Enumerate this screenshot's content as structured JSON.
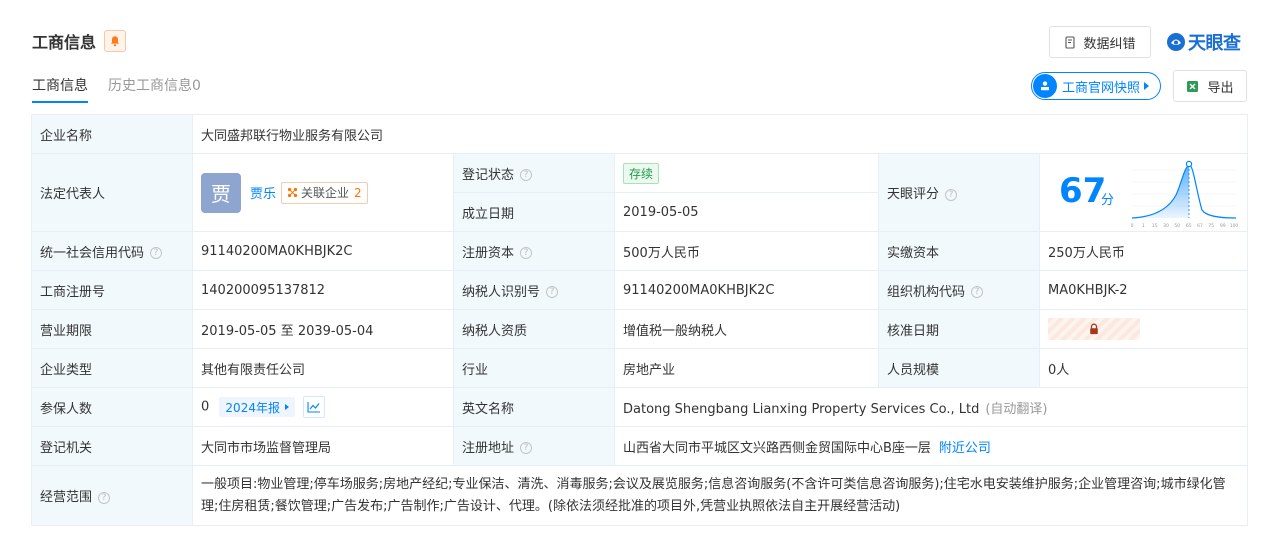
{
  "header": {
    "title": "工商信息",
    "correct_button": "数据纠错",
    "brand": "天眼查"
  },
  "tabs": [
    {
      "label": "工商信息"
    },
    {
      "label": "历史工商信息0"
    }
  ],
  "actions": {
    "snapshot_label": "工商官网快照",
    "export_label": "导出"
  },
  "labels": {
    "company_name": "企业名称",
    "legal_rep": "法定代表人",
    "reg_status": "登记状态",
    "established": "成立日期",
    "tianyan_score": "天眼评分",
    "credit_code": "统一社会信用代码",
    "reg_capital": "注册资本",
    "paid_capital": "实缴资本",
    "reg_number": "工商注册号",
    "taxpayer_id": "纳税人识别号",
    "org_code": "组织机构代码",
    "term": "营业期限",
    "taxpayer_qual": "纳税人资质",
    "approval_date": "核准日期",
    "company_type": "企业类型",
    "industry": "行业",
    "staff_size": "人员规模",
    "insured": "参保人数",
    "english_name": "英文名称",
    "reg_authority": "登记机关",
    "reg_address": "注册地址",
    "scope": "经营范围"
  },
  "values": {
    "company_name": "大同盛邦联行物业服务有限公司",
    "legal_rep": {
      "avatar_char": "贾",
      "name": "贾乐",
      "related_label": "关联企业",
      "related_count": "2"
    },
    "reg_status": "存续",
    "established": "2019-05-05",
    "score": {
      "value": "67",
      "unit": "分",
      "axis_ticks": [
        "0",
        "1",
        "15",
        "30",
        "50",
        "65",
        "67",
        "75",
        "99",
        "100"
      ]
    },
    "credit_code": "91140200MA0KHBJK2C",
    "reg_capital": "500万人民币",
    "paid_capital": "250万人民币",
    "reg_number": "140200095137812",
    "taxpayer_id": "91140200MA0KHBJK2C",
    "org_code": "MA0KHBJK-2",
    "term": "2019-05-05 至 2039-05-04",
    "taxpayer_qual": "增值税一般纳税人",
    "company_type": "其他有限责任公司",
    "industry": "房地产业",
    "staff_size": "0人",
    "insured": {
      "count": "0",
      "report_label": "2024年报"
    },
    "english_name": "Datong Shengbang Lianxing Property Services Co., Ltd",
    "auto_translate": "(自动翻译)",
    "reg_authority": "大同市市场监督管理局",
    "reg_address": "山西省大同市平城区文兴路西侧金贸国际中心B座一层",
    "nearby_link": "附近公司",
    "scope": "一般项目:物业管理;停车场服务;房地产经纪;专业保洁、清洗、消毒服务;会议及展览服务;信息咨询服务(不含许可类信息咨询服务);住宅水电安装维护服务;企业管理咨询;城市绿化管理;住房租赁;餐饮管理;广告发布;广告制作;广告设计、代理。(除依法须经批准的项目外,凭营业执照依法自主开展经营活动)"
  },
  "colors": {
    "accent": "#0084ff",
    "label_bg": "#f2f9fc",
    "status_green": "#1f9c4b",
    "warn_orange": "#ff7500"
  }
}
